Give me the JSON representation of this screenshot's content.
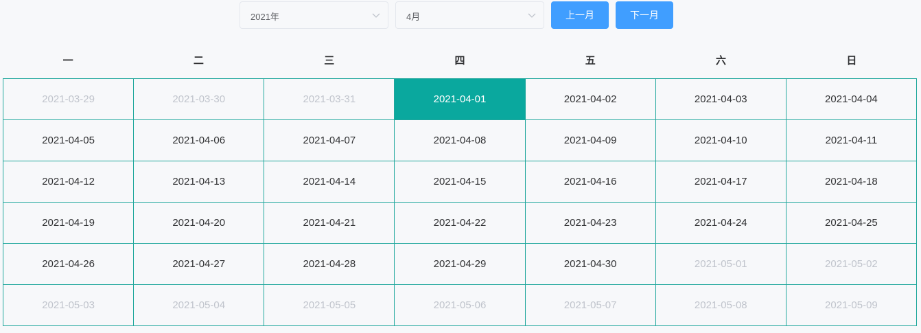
{
  "toolbar": {
    "year_select": {
      "value": "2021年"
    },
    "month_select": {
      "value": "4月"
    },
    "prev_label": "上一月",
    "next_label": "下一月"
  },
  "colors": {
    "accent_button": "#409eff",
    "selected_cell": "#0aa89e",
    "grid_line": "#1fa79c",
    "muted_text": "#c0c4cc"
  },
  "calendar": {
    "weekdays": [
      "一",
      "二",
      "三",
      "四",
      "五",
      "六",
      "日"
    ],
    "selected": "2021-04-01",
    "weeks": [
      [
        {
          "date": "2021-03-29",
          "other": true
        },
        {
          "date": "2021-03-30",
          "other": true
        },
        {
          "date": "2021-03-31",
          "other": true
        },
        {
          "date": "2021-04-01",
          "other": false
        },
        {
          "date": "2021-04-02",
          "other": false
        },
        {
          "date": "2021-04-03",
          "other": false
        },
        {
          "date": "2021-04-04",
          "other": false
        }
      ],
      [
        {
          "date": "2021-04-05",
          "other": false
        },
        {
          "date": "2021-04-06",
          "other": false
        },
        {
          "date": "2021-04-07",
          "other": false
        },
        {
          "date": "2021-04-08",
          "other": false
        },
        {
          "date": "2021-04-09",
          "other": false
        },
        {
          "date": "2021-04-10",
          "other": false
        },
        {
          "date": "2021-04-11",
          "other": false
        }
      ],
      [
        {
          "date": "2021-04-12",
          "other": false
        },
        {
          "date": "2021-04-13",
          "other": false
        },
        {
          "date": "2021-04-14",
          "other": false
        },
        {
          "date": "2021-04-15",
          "other": false
        },
        {
          "date": "2021-04-16",
          "other": false
        },
        {
          "date": "2021-04-17",
          "other": false
        },
        {
          "date": "2021-04-18",
          "other": false
        }
      ],
      [
        {
          "date": "2021-04-19",
          "other": false
        },
        {
          "date": "2021-04-20",
          "other": false
        },
        {
          "date": "2021-04-21",
          "other": false
        },
        {
          "date": "2021-04-22",
          "other": false
        },
        {
          "date": "2021-04-23",
          "other": false
        },
        {
          "date": "2021-04-24",
          "other": false
        },
        {
          "date": "2021-04-25",
          "other": false
        }
      ],
      [
        {
          "date": "2021-04-26",
          "other": false
        },
        {
          "date": "2021-04-27",
          "other": false
        },
        {
          "date": "2021-04-28",
          "other": false
        },
        {
          "date": "2021-04-29",
          "other": false
        },
        {
          "date": "2021-04-30",
          "other": false
        },
        {
          "date": "2021-05-01",
          "other": true
        },
        {
          "date": "2021-05-02",
          "other": true
        }
      ],
      [
        {
          "date": "2021-05-03",
          "other": true
        },
        {
          "date": "2021-05-04",
          "other": true
        },
        {
          "date": "2021-05-05",
          "other": true
        },
        {
          "date": "2021-05-06",
          "other": true
        },
        {
          "date": "2021-05-07",
          "other": true
        },
        {
          "date": "2021-05-08",
          "other": true
        },
        {
          "date": "2021-05-09",
          "other": true
        }
      ]
    ]
  }
}
